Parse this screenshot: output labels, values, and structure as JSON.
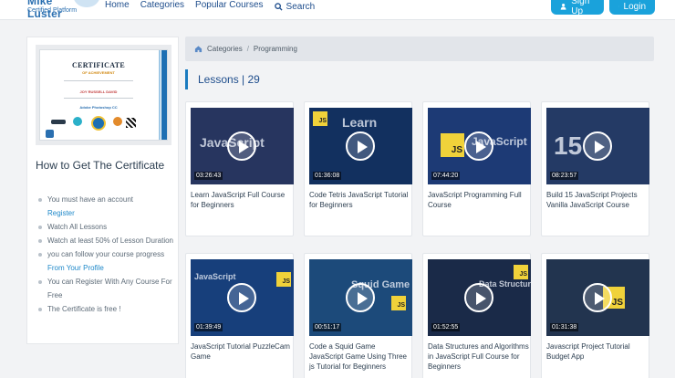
{
  "header": {
    "logo_line1": "Mike Luster",
    "logo_line2": "Certified Platform",
    "nav": [
      "Home",
      "Categories",
      "Popular Courses"
    ],
    "search_label": "Search",
    "signup_label": "Sign Up",
    "login_label": "Login"
  },
  "certificate": {
    "title": "CERTIFICATE",
    "subtitle": "OF ACHIEVEMENT",
    "recipient": "JOY RUSSELL DAVID",
    "course": "Adobe Photoshop CC"
  },
  "how": {
    "title": "How to Get The Certificate",
    "rule1": "You must have an account",
    "rule1_link": "Register",
    "rule2": "Watch All Lessons",
    "rule3": "Watch at least 50% of Lesson Duration",
    "rule4": "you can follow your course progress",
    "rule4_link": "From Your Profile",
    "rule5": "You can Register With Any Course For Free",
    "rule6": "The Certificate is free !"
  },
  "breadcrumb": {
    "home": "Categories",
    "separator": "/",
    "current": "Programming"
  },
  "lessons": {
    "heading": "Lessons | 29",
    "cards": [
      {
        "title": "Learn JavaScript Full Course for Beginners",
        "duration": "03:26:43",
        "art": "JavaScript",
        "bg": "#27355f"
      },
      {
        "title": "Code Tetris JavaScript Tutorial for Beginners",
        "duration": "01:36:08",
        "art": "Learn",
        "bg": "#12305f"
      },
      {
        "title": "JavaScript Programming Full Course",
        "duration": "07:44:20",
        "art": "JavaScript",
        "bg": "#1d3a75"
      },
      {
        "title": "Build 15 JavaScript Projects Vanilla JavaScript Course",
        "duration": "08:23:57",
        "art": "15",
        "bg": "#243a65"
      },
      {
        "title": "JavaScript Tutorial PuzzleCam Game",
        "duration": "01:39:49",
        "art": "JavaScript",
        "bg": "#173f7b"
      },
      {
        "title": "Code a Squid Game JavaScript Game Using Three js Tutorial for Beginners",
        "duration": "00:51:17",
        "art": "Squid Game",
        "bg": "#1c4a7a"
      },
      {
        "title": "Data Structures and Algorithms in JavaScript Full Course for Beginners",
        "duration": "01:52:55",
        "art": "Data Structures",
        "bg": "#1a2a48"
      },
      {
        "title": "Javascript Project Tutorial Budget App",
        "duration": "01:31:38",
        "art": "",
        "bg": "#22344f"
      }
    ]
  }
}
